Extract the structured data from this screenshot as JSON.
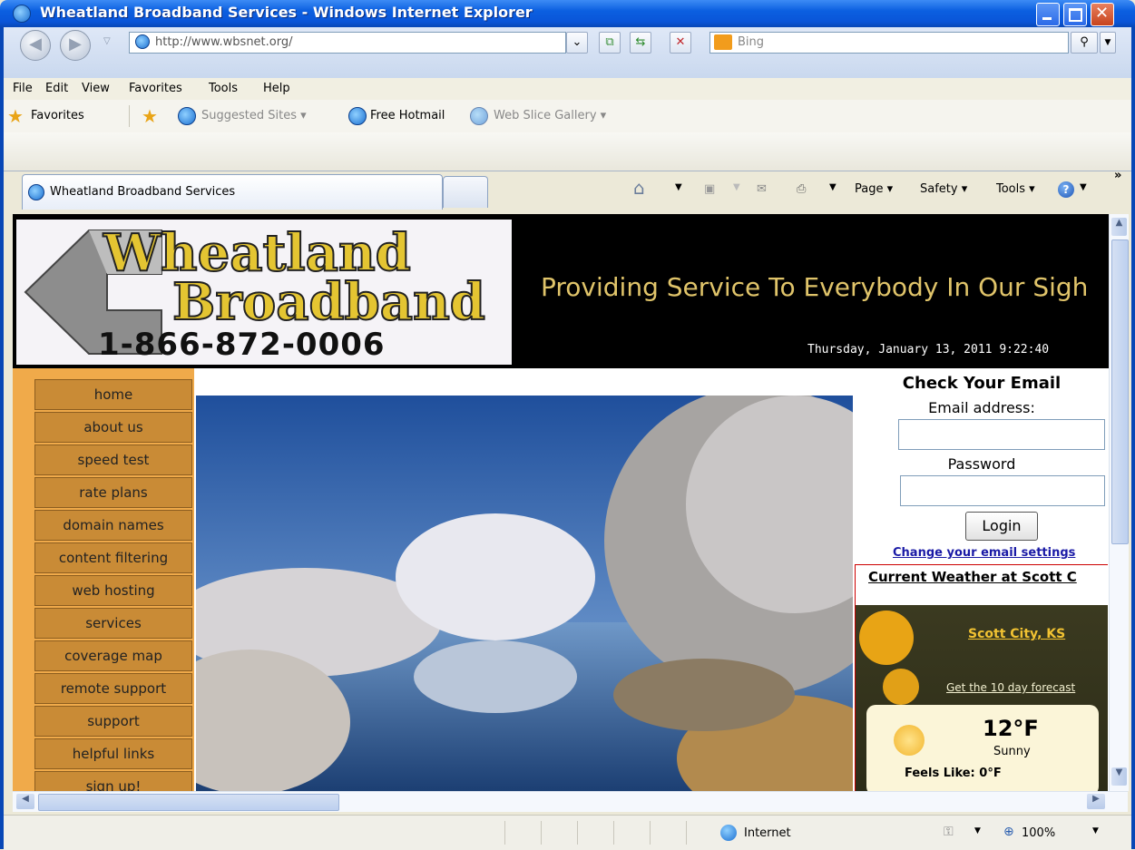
{
  "window": {
    "title": "Wheatland Broadband Services - Windows Internet Explorer"
  },
  "address_bar": {
    "url": "http://www.wbsnet.org/",
    "search_placeholder": "Bing"
  },
  "menu": {
    "items": [
      "File",
      "Edit",
      "View",
      "Favorites",
      "Tools",
      "Help"
    ]
  },
  "favorites_bar": {
    "favorites_label": "Favorites",
    "links": [
      "Suggested Sites ▾",
      "Free Hotmail",
      "Web Slice Gallery ▾"
    ]
  },
  "tab": {
    "title": "Wheatland Broadband Services"
  },
  "command_bar": {
    "page": "Page ▾",
    "safety": "Safety ▾",
    "tools": "Tools ▾"
  },
  "site": {
    "logo": {
      "line1": "Wheatland",
      "line2": "Broadband",
      "phone": "1-866-872-0006"
    },
    "slogan": "Providing Service To Everybody In Our Sigh",
    "datetime": "Thursday, January 13, 2011 9:22:40",
    "nav": [
      "home",
      "about us",
      "speed test",
      "rate plans",
      "domain names",
      "content filtering",
      "web hosting",
      "services",
      "coverage map",
      "remote support",
      "support",
      "helpful links",
      "sign up!"
    ],
    "email": {
      "heading": "Check Your Email",
      "address_label": "Email address:",
      "password_label": "Password",
      "login_button": "Login",
      "settings_link": "Change your email settings"
    },
    "weather": {
      "heading": "Current Weather at Scott C",
      "city": "Scott City, KS",
      "forecast_link": "Get the 10 day forecast",
      "temp": "12°F",
      "condition": "Sunny",
      "feels_like": "Feels Like: 0°F"
    }
  },
  "status_bar": {
    "zone": "Internet",
    "zoom": "100%"
  }
}
